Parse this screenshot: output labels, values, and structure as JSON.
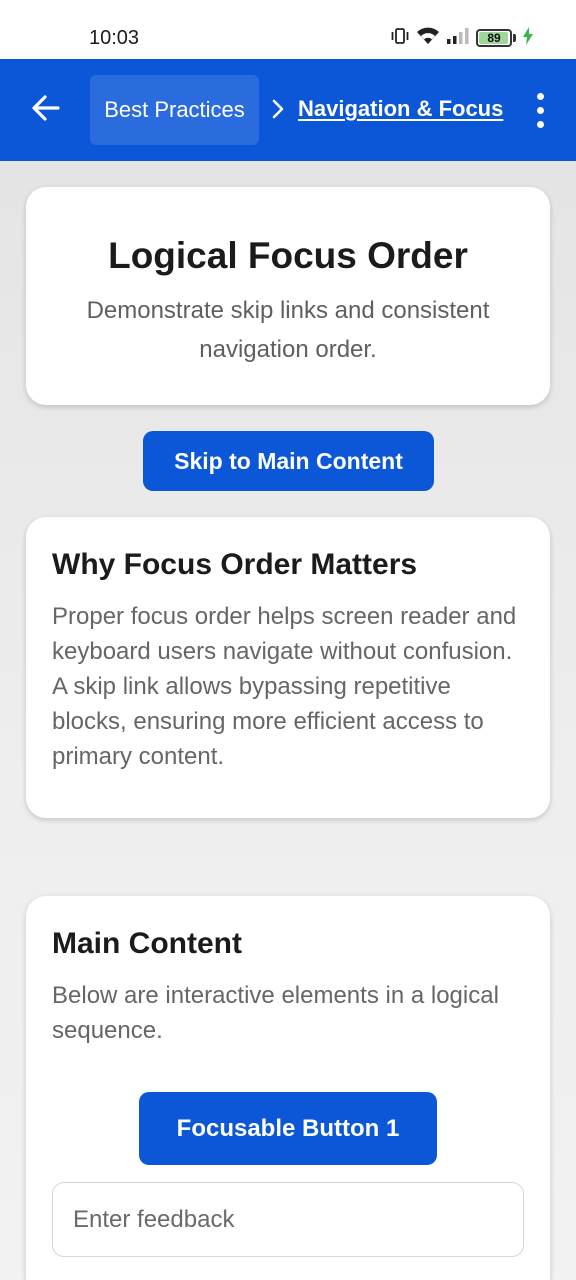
{
  "status_bar": {
    "time": "10:03",
    "battery_level": "89",
    "icons": [
      "vibrate-icon",
      "wifi-icon",
      "signal-icon",
      "battery-icon",
      "charging-icon"
    ]
  },
  "app_bar": {
    "breadcrumb_parent": "Best Practices",
    "breadcrumb_current": "Navigation & Focus",
    "back_icon": "arrow-left-icon",
    "menu_icon": "more-vertical-icon",
    "color": "#0b57d8"
  },
  "hero": {
    "title": "Logical Focus Order",
    "subtitle": "Demonstrate skip links and consistent navigation order."
  },
  "skip_link": {
    "label": "Skip to Main Content"
  },
  "why": {
    "title": "Why Focus Order Matters",
    "body": "Proper focus order helps screen reader and keyboard users navigate without confusion. A skip link allows bypassing repetitive blocks, ensuring more efficient access to primary content."
  },
  "main": {
    "title": "Main Content",
    "body": "Below are interactive elements in a logical sequence.",
    "button_label": "Focusable Button 1",
    "feedback_placeholder": "Enter feedback"
  }
}
